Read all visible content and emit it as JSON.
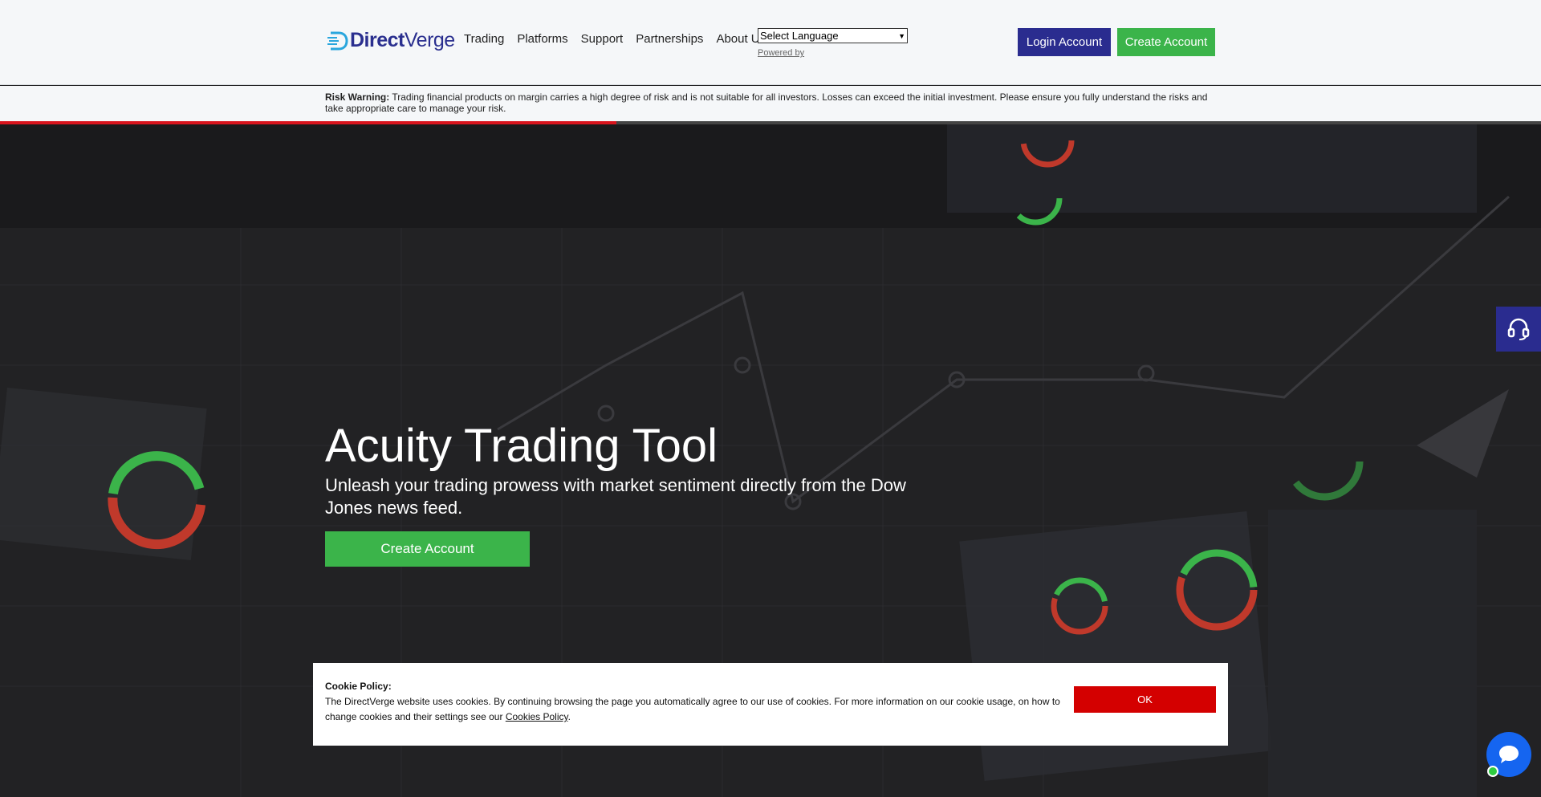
{
  "brand": {
    "logo_bold": "Direct",
    "logo_rest": "Verge"
  },
  "nav": {
    "items": [
      {
        "label": "Trading"
      },
      {
        "label": "Platforms"
      },
      {
        "label": "Support"
      },
      {
        "label": "Partnerships"
      },
      {
        "label": "About Us"
      }
    ]
  },
  "language": {
    "selected": "Select Language",
    "powered_by": "Powered by"
  },
  "header_buttons": {
    "login": "Login Account",
    "create": "Create Account"
  },
  "risk": {
    "label": "Risk Warning:",
    "text": "Trading financial products on margin carries a high degree of risk and is not suitable for all investors. Losses can exceed the initial investment. Please ensure you fully understand the risks and take appropriate care to manage your risk.",
    "slider_progress": 0.4
  },
  "hero": {
    "title": "Acuity Trading Tool",
    "subtitle": "Unleash your trading prowess with market sentiment directly from the Dow Jones news feed.",
    "cta": "Create Account"
  },
  "cookie": {
    "title": "Cookie Policy:",
    "text": "The DirectVerge website uses cookies. By continuing browsing the page you automatically agree to our use of cookies. For more information on our cookie usage, on how to change cookies and their settings see our ",
    "link": "Cookies Policy",
    "end": ".",
    "ok": "OK"
  },
  "colors": {
    "brand_blue": "#2a2c8f",
    "green": "#3bb44a",
    "red": "#d40000",
    "chat_blue": "#1565f0"
  },
  "icons": {
    "support": "headset-icon",
    "chat": "chat-bubble-icon"
  }
}
